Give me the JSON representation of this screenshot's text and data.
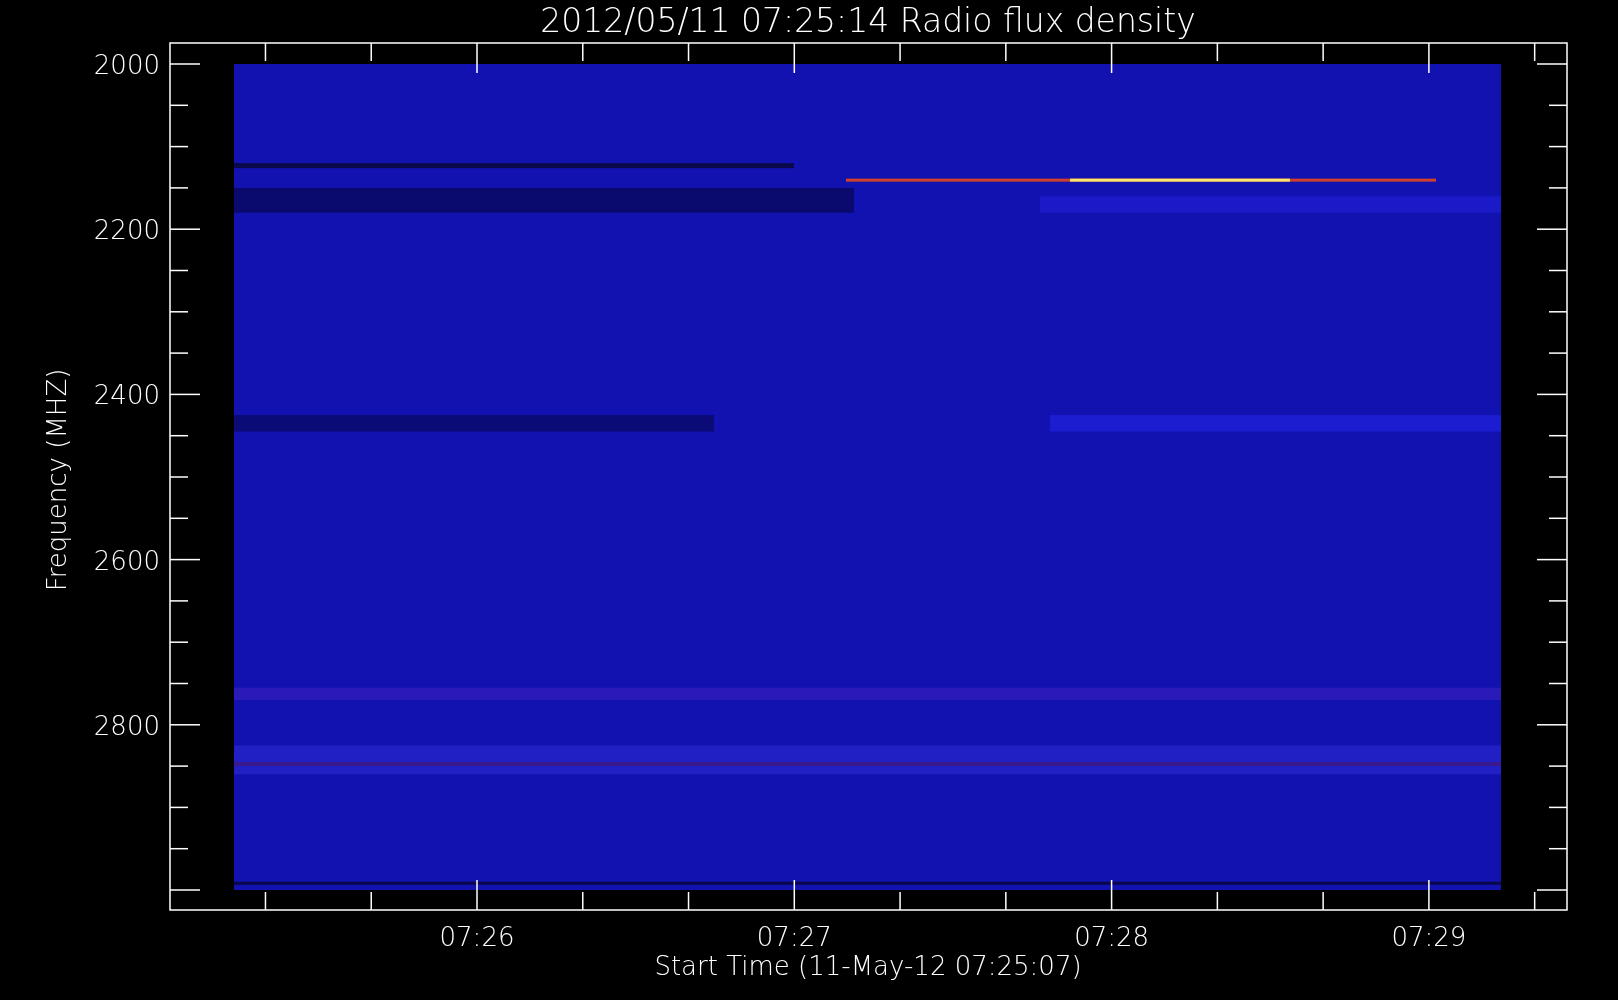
{
  "title": "2012/05/11 07:25:14 Radio flux density",
  "ylabel": "Frequency (MHZ)",
  "xlabel": "Start Time (11-May-12 07:25:07)",
  "y_ticks": [
    "2000",
    "2200",
    "2400",
    "2600",
    "2800"
  ],
  "x_ticks": [
    "07:26",
    "07:27",
    "07:28",
    "07:29"
  ]
}
